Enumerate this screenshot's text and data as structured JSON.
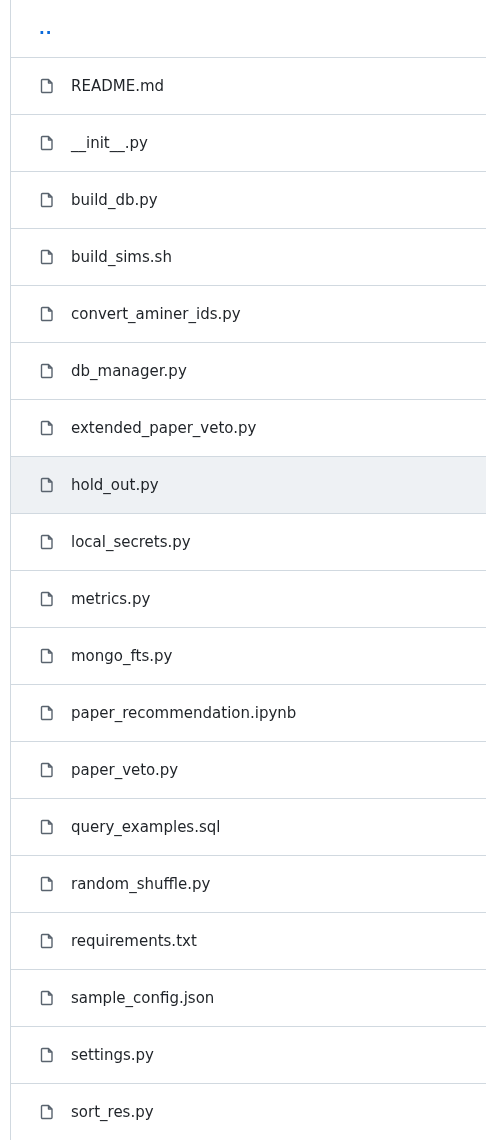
{
  "parent_link": {
    "label": ".."
  },
  "files": [
    {
      "name": "README.md",
      "hovered": false
    },
    {
      "name": "__init__.py",
      "hovered": false
    },
    {
      "name": "build_db.py",
      "hovered": false
    },
    {
      "name": "build_sims.sh",
      "hovered": false
    },
    {
      "name": "convert_aminer_ids.py",
      "hovered": false
    },
    {
      "name": "db_manager.py",
      "hovered": false
    },
    {
      "name": "extended_paper_veto.py",
      "hovered": false
    },
    {
      "name": "hold_out.py",
      "hovered": true
    },
    {
      "name": "local_secrets.py",
      "hovered": false
    },
    {
      "name": "metrics.py",
      "hovered": false
    },
    {
      "name": "mongo_fts.py",
      "hovered": false
    },
    {
      "name": "paper_recommendation.ipynb",
      "hovered": false
    },
    {
      "name": "paper_veto.py",
      "hovered": false
    },
    {
      "name": "query_examples.sql",
      "hovered": false
    },
    {
      "name": "random_shuffle.py",
      "hovered": false
    },
    {
      "name": "requirements.txt",
      "hovered": false
    },
    {
      "name": "sample_config.json",
      "hovered": false
    },
    {
      "name": "settings.py",
      "hovered": false
    },
    {
      "name": "sort_res.py",
      "hovered": false
    }
  ]
}
